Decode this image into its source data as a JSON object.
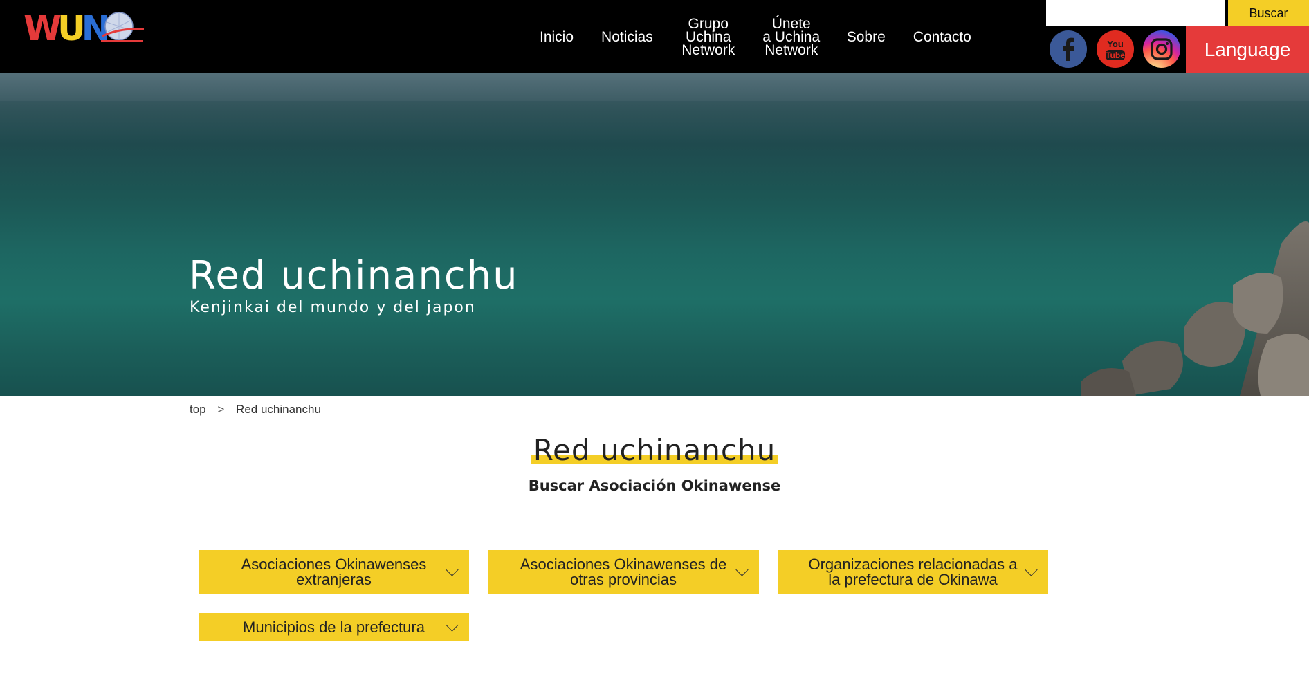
{
  "header": {
    "logo_text": "WUN",
    "logo_colors": [
      "#e53a3a",
      "#f4ce26",
      "#2aa34a",
      "#2a6ed6"
    ],
    "nav": [
      {
        "label": "Inicio"
      },
      {
        "label": "Noticias"
      },
      {
        "label": "Grupo\nUchina\nNetwork"
      },
      {
        "label": "Únete\na Uchina\nNetwork"
      },
      {
        "label": "Sobre"
      },
      {
        "label": "Contacto"
      }
    ],
    "search": {
      "value": "",
      "button_label": "Buscar"
    },
    "social": {
      "facebook": "facebook-icon",
      "youtube": "youtube-icon",
      "instagram": "instagram-icon"
    },
    "language_label": "Language"
  },
  "hero": {
    "title": "Red uchinanchu",
    "subtitle": "Kenjinkai del mundo y del japon"
  },
  "breadcrumb": {
    "home": "top",
    "separator": ">",
    "current": "Red uchinanchu"
  },
  "main": {
    "title": "Red uchinanchu",
    "subtitle": "Buscar Asociación Okinawense",
    "categories": [
      {
        "label": "Asociaciones Okinawenses extranjeras"
      },
      {
        "label": "Asociaciones Okinawenses de otras provincias"
      },
      {
        "label": "Organizaciones relacionadas a la prefectura de Okinawa"
      },
      {
        "label": "Municipios de la prefectura"
      }
    ]
  },
  "colors": {
    "accent_yellow": "#f4ce26",
    "language_red": "#e53a3a",
    "header_bg": "#000000"
  }
}
